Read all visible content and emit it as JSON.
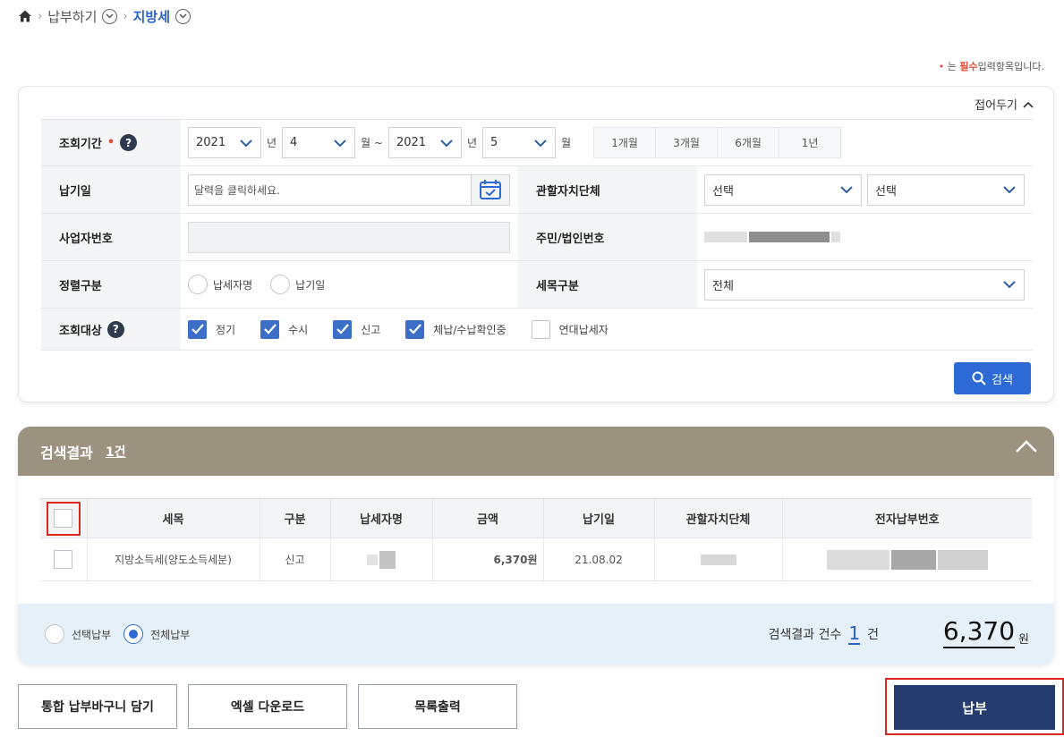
{
  "breadcrumb": {
    "level1": "납부하기",
    "level2": "지방세"
  },
  "required_note": {
    "prefix": "는",
    "word": "필수",
    "suffix": "입력항목입니다."
  },
  "search": {
    "collapse_label": "접어두기",
    "period": {
      "label": "조회기간",
      "start_year": "2021",
      "start_month": "4",
      "end_year": "2021",
      "end_month": "5",
      "unit_year": "년",
      "unit_month_range": "월 ~",
      "unit_month": "월",
      "quick": [
        "1개월",
        "3개월",
        "6개월",
        "1년"
      ]
    },
    "due_date": {
      "label": "납기일",
      "placeholder": "달력을 클릭하세요."
    },
    "jurisdiction": {
      "label": "관할자치단체",
      "select1": "선택",
      "select2": "선택"
    },
    "business_no": {
      "label": "사업자번호"
    },
    "resident_no": {
      "label": "주민/법인번호"
    },
    "sort": {
      "label": "정렬구분",
      "options": [
        "납세자명",
        "납기일"
      ]
    },
    "tax_type": {
      "label": "세목구분",
      "value": "전체"
    },
    "target": {
      "label": "조회대상",
      "options": [
        {
          "label": "정기",
          "checked": true
        },
        {
          "label": "수시",
          "checked": true
        },
        {
          "label": "신고",
          "checked": true
        },
        {
          "label": "체납/수납확인중",
          "checked": true
        },
        {
          "label": "연대납세자",
          "checked": false
        }
      ]
    },
    "search_button": "검색"
  },
  "result": {
    "title": "검색결과",
    "count_label": "1건",
    "columns": [
      "세목",
      "구분",
      "납세자명",
      "금액",
      "납기일",
      "관할자치단체",
      "전자납부번호"
    ],
    "rows": [
      {
        "tax": "지방소득세(양도소득세분)",
        "type": "신고",
        "amount": "6,370원",
        "due": "21.08.02"
      }
    ],
    "pay_mode": {
      "selected_label": "선택납부",
      "all_label": "전체납부",
      "selected": "all"
    },
    "total_count_label": "검색결과 건수",
    "total_count": "1",
    "total_count_unit": "건",
    "total_amount": "6,370",
    "total_amount_unit": "원"
  },
  "actions": {
    "cart": "통합 납부바구니 담기",
    "excel": "엑셀 다운로드",
    "print": "목록출력",
    "pay": "납부"
  }
}
